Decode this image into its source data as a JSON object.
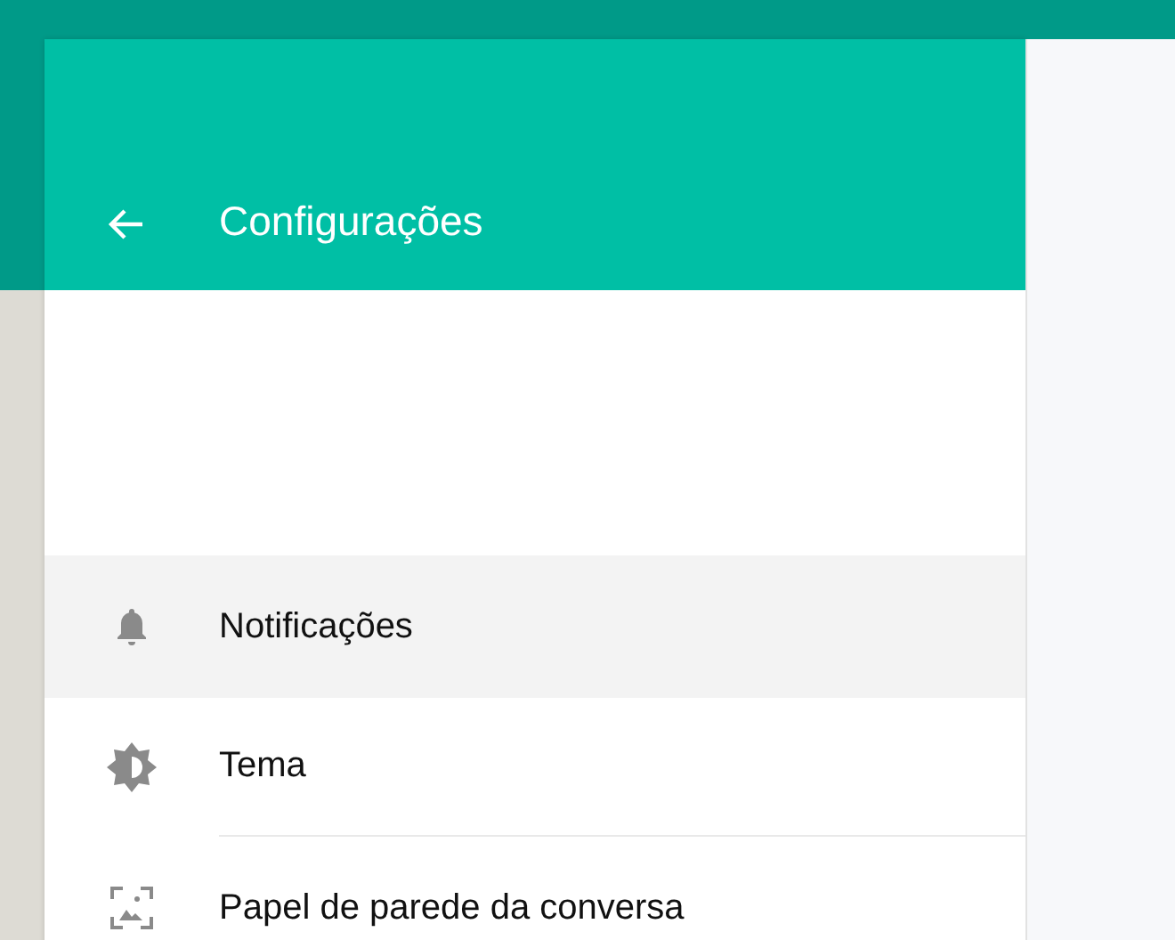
{
  "header": {
    "title": "Configurações"
  },
  "items": [
    {
      "kind": "notifications",
      "label": "Notificações",
      "selected": true
    },
    {
      "kind": "theme",
      "label": "Tema",
      "selected": false
    },
    {
      "kind": "wallpaper",
      "label": "Papel de parede da conversa",
      "selected": false
    }
  ]
}
